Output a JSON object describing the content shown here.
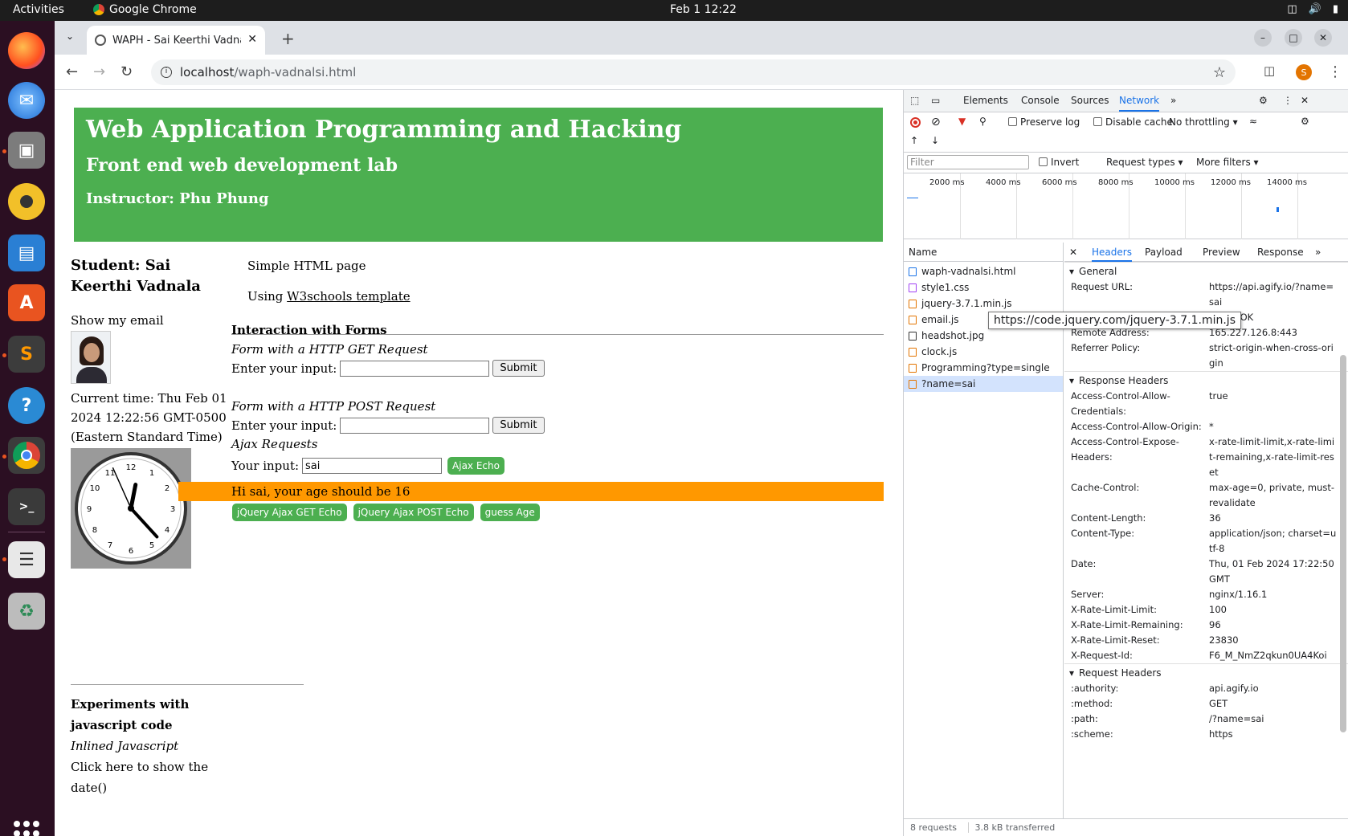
{
  "system": {
    "activities": "Activities",
    "app_name": "Google Chrome",
    "datetime": "Feb 1  12:22"
  },
  "browser": {
    "tab_title": "WAPH - Sai Keerthi Vadnalsi",
    "url_host": "localhost",
    "url_path": "/waph-vadnalsi.html",
    "avatar_letter": "S"
  },
  "page": {
    "banner_title": "Web Application Programming and Hacking",
    "banner_subtitle": "Front end web development lab",
    "banner_instructor": "Instructor: Phu Phung",
    "student": "Student: Sai Keerthi Vadnala",
    "show_email": "Show my email",
    "current_time": "Current time: Thu Feb 01 2024 12:22:56 GMT-0500 (Eastern Standard Time)",
    "clock": {
      "hours": 12,
      "minutes": 22,
      "seconds": 56
    },
    "simple_page": "Simple HTML page",
    "using_prefix": "Using ",
    "w3_link": "W3schools template",
    "experiments_heading": "Experiments with javascript code",
    "inlined_js": "Inlined Javascript",
    "show_date": "Click here to show the date()",
    "forms_heading": "Interaction with Forms",
    "get_form_title": "Form with a HTTP GET Request",
    "post_form_title": "Form with a HTTP POST Request",
    "enter_input_label": "Enter your input:",
    "submit": "Submit",
    "ajax_heading": "Ajax Requests",
    "your_input_label": "Your input:",
    "ajax_input_value": "sai",
    "ajax_echo": "Ajax Echo",
    "age_result": "Hi sai, your age should be 16",
    "jquery_get": "jQuery Ajax GET Echo",
    "jquery_post": "jQuery Ajax POST Echo",
    "guess_age": "guess Age",
    "accent_color": "#4caf50",
    "result_color": "#ff9800"
  },
  "devtools": {
    "tabs": [
      "Elements",
      "Console",
      "Sources",
      "Network"
    ],
    "preserve_log": "Preserve log",
    "disable_cache": "Disable cache",
    "throttling": "No throttling",
    "filter_placeholder": "Filter",
    "invert": "Invert",
    "request_types": "Request types",
    "more_filters": "More filters",
    "timeline_ticks": [
      "2000 ms",
      "4000 ms",
      "6000 ms",
      "8000 ms",
      "10000 ms",
      "12000 ms",
      "14000 ms"
    ],
    "name_header": "Name",
    "requests": [
      {
        "name": "waph-vadnalsi.html",
        "icon": "document-icon"
      },
      {
        "name": "style1.css",
        "icon": "stylesheet-icon"
      },
      {
        "name": "jquery-3.7.1.min.js",
        "icon": "script-icon"
      },
      {
        "name": "email.js",
        "icon": "script-icon"
      },
      {
        "name": "headshot.jpg",
        "icon": "image-icon"
      },
      {
        "name": "clock.js",
        "icon": "script-icon"
      },
      {
        "name": "Programming?type=single",
        "icon": "fetch-icon"
      },
      {
        "name": "?name=sai",
        "icon": "fetch-icon"
      }
    ],
    "tooltip": "https://code.jquery.com/jquery-3.7.1.min.js",
    "footer_requests": "8 requests",
    "footer_transferred": "3.8 kB transferred",
    "detail_tabs": [
      "Headers",
      "Payload",
      "Preview",
      "Response"
    ],
    "general_title": "General",
    "general": [
      {
        "k": "Request URL:",
        "v": "https://api.agify.io/?name=sai"
      },
      {
        "k": "Status Code:",
        "v": "200 OK"
      },
      {
        "k": "Remote Address:",
        "v": "165.227.126.8:443"
      },
      {
        "k": "Referrer Policy:",
        "v": "strict-origin-when-cross-origin"
      }
    ],
    "response_title": "Response Headers",
    "response": [
      {
        "k": "Access-Control-Allow-Credentials:",
        "v": "true"
      },
      {
        "k": "Access-Control-Allow-Origin:",
        "v": "*"
      },
      {
        "k": "Access-Control-Expose-Headers:",
        "v": "x-rate-limit-limit,x-rate-limit-remaining,x-rate-limit-reset"
      },
      {
        "k": "Cache-Control:",
        "v": "max-age=0, private, must-revalidate"
      },
      {
        "k": "Content-Length:",
        "v": "36"
      },
      {
        "k": "Content-Type:",
        "v": "application/json; charset=utf-8"
      },
      {
        "k": "Date:",
        "v": "Thu, 01 Feb 2024 17:22:50 GMT"
      },
      {
        "k": "Server:",
        "v": "nginx/1.16.1"
      },
      {
        "k": "X-Rate-Limit-Limit:",
        "v": "100"
      },
      {
        "k": "X-Rate-Limit-Remaining:",
        "v": "96"
      },
      {
        "k": "X-Rate-Limit-Reset:",
        "v": "23830"
      },
      {
        "k": "X-Request-Id:",
        "v": "F6_M_NmZ2qkun0UA4Koi"
      }
    ],
    "request_title": "Request Headers",
    "request": [
      {
        "k": ":authority:",
        "v": "api.agify.io"
      },
      {
        "k": ":method:",
        "v": "GET"
      },
      {
        "k": ":path:",
        "v": "/?name=sai"
      },
      {
        "k": ":scheme:",
        "v": "https"
      }
    ]
  }
}
